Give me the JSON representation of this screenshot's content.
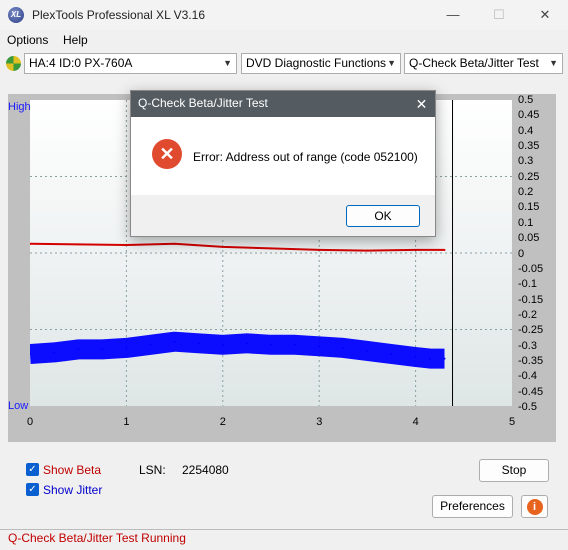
{
  "window": {
    "title": "PlexTools Professional XL V3.16",
    "icon_text": "XL",
    "minimize_glyph": "—",
    "maximize_glyph": "☐",
    "close_glyph": "✕"
  },
  "menu": [
    "Options",
    "Help"
  ],
  "toolbar": {
    "drive": "HA:4 ID:0  PX-760A",
    "function": "DVD Diagnostic Functions",
    "test": "Q-Check Beta/Jitter Test"
  },
  "chart": {
    "left_top_label": "High",
    "left_bottom_label": "Low",
    "right_ticks": [
      "0.5",
      "0.45",
      "0.4",
      "0.35",
      "0.3",
      "0.25",
      "0.2",
      "0.15",
      "0.1",
      "0.05",
      "0",
      "-0.05",
      "-0.1",
      "-0.15",
      "-0.2",
      "-0.25",
      "-0.3",
      "-0.35",
      "-0.4",
      "-0.45",
      "-0.5"
    ],
    "x_ticks": [
      "0",
      "1",
      "2",
      "3",
      "4",
      "5"
    ]
  },
  "chart_data": {
    "type": "line",
    "x_range": [
      0,
      5
    ],
    "y_range": [
      -0.5,
      0.5
    ],
    "x_ticks": [
      0,
      1,
      2,
      3,
      4,
      5
    ],
    "y_ticks_right": [
      0.5,
      0.45,
      0.4,
      0.35,
      0.3,
      0.25,
      0.2,
      0.15,
      0.1,
      0.05,
      0,
      -0.05,
      -0.1,
      -0.15,
      -0.2,
      -0.25,
      -0.3,
      -0.35,
      -0.4,
      -0.45,
      -0.5
    ],
    "grid": true,
    "series": [
      {
        "name": "Beta",
        "color": "#d40000",
        "x": [
          0,
          0.5,
          1,
          1.5,
          2,
          2.5,
          3,
          3.5,
          4,
          4.3
        ],
        "y": [
          0.03,
          0.028,
          0.026,
          0.03,
          0.02,
          0.015,
          0.01,
          0.008,
          0.01,
          0.01
        ]
      },
      {
        "name": "Jitter",
        "color": "#0000ff",
        "x": [
          0,
          0.25,
          0.5,
          0.75,
          1,
          1.25,
          1.5,
          1.75,
          2,
          2.25,
          2.5,
          2.75,
          3,
          3.25,
          3.5,
          3.75,
          4,
          4.15,
          4.3
        ],
        "y": [
          -0.33,
          -0.325,
          -0.315,
          -0.315,
          -0.31,
          -0.3,
          -0.29,
          -0.295,
          -0.3,
          -0.295,
          -0.3,
          -0.3,
          -0.305,
          -0.31,
          -0.32,
          -0.33,
          -0.34,
          -0.345,
          -0.345
        ]
      }
    ]
  },
  "controls": {
    "show_beta_label": "Show Beta",
    "show_jitter_label": "Show Jitter",
    "lsn_label": "LSN:",
    "lsn_value": "2254080",
    "stop_label": "Stop",
    "preferences_label": "Preferences",
    "info_glyph": "i",
    "check_glyph": "✓"
  },
  "status": "Q-Check Beta/Jitter Test Running",
  "dialog": {
    "title": "Q-Check Beta/Jitter Test",
    "message": "Error: Address out of range (code 052100)",
    "ok_label": "OK",
    "close_glyph": "✕",
    "error_glyph": "✕"
  },
  "colors": {
    "beta": "#d40000",
    "jitter": "#0000ff",
    "status_text": "#c00000",
    "dialog_titlebar": "#545b61",
    "error_icon": "#e04a2f"
  }
}
